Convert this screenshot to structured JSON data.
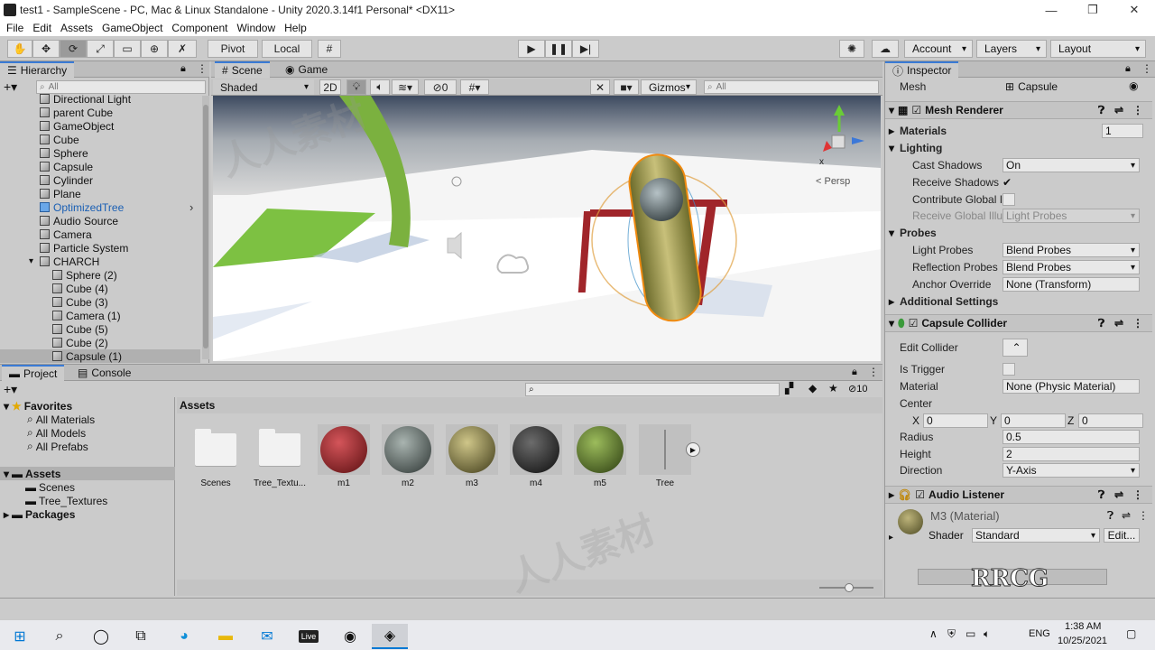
{
  "window": {
    "title": "test1 - SampleScene - PC, Mac & Linux Standalone - Unity 2020.3.14f1 Personal* <DX11>",
    "controls": [
      "—",
      "❐",
      "✕"
    ]
  },
  "menu": [
    "File",
    "Edit",
    "Assets",
    "GameObject",
    "Component",
    "Window",
    "Help"
  ],
  "toolbar": {
    "pivot": "Pivot",
    "local": "Local",
    "account": "Account",
    "layers": "Layers",
    "layout": "Layout"
  },
  "hierarchy": {
    "tab": "Hierarchy",
    "search_placeholder": "All",
    "items": [
      {
        "label": "Directional Light",
        "depth": 1
      },
      {
        "label": "parent Cube",
        "depth": 1
      },
      {
        "label": "GameObject",
        "depth": 1
      },
      {
        "label": "Cube",
        "depth": 1
      },
      {
        "label": "Sphere",
        "depth": 1
      },
      {
        "label": "Capsule",
        "depth": 1
      },
      {
        "label": "Cylinder",
        "depth": 1
      },
      {
        "label": "Plane",
        "depth": 1
      },
      {
        "label": "OptimizedTree",
        "depth": 1,
        "prefab": true
      },
      {
        "label": "Audio Source",
        "depth": 1
      },
      {
        "label": "Camera",
        "depth": 1
      },
      {
        "label": "Particle System",
        "depth": 1
      },
      {
        "label": "CHARCH",
        "depth": 1,
        "expanded": true
      },
      {
        "label": "Sphere (2)",
        "depth": 2
      },
      {
        "label": "Cube (4)",
        "depth": 2
      },
      {
        "label": "Cube (3)",
        "depth": 2
      },
      {
        "label": "Camera (1)",
        "depth": 2
      },
      {
        "label": "Cube (5)",
        "depth": 2
      },
      {
        "label": "Cube (2)",
        "depth": 2
      },
      {
        "label": "Capsule (1)",
        "depth": 2,
        "selected": true
      }
    ]
  },
  "scene": {
    "tabs": [
      "Scene",
      "Game"
    ],
    "shading": "Shaded",
    "mode_2d": "2D",
    "hidden_count": "0",
    "gizmos": "Gizmos",
    "search_placeholder": "All",
    "persp": "< Persp",
    "axis_x": "x"
  },
  "project": {
    "tabs": [
      "Project",
      "Console"
    ],
    "hidden_count": "10",
    "favorites": {
      "label": "Favorites",
      "items": [
        "All Materials",
        "All Models",
        "All Prefabs"
      ]
    },
    "assets_tree": {
      "label": "Assets",
      "children": [
        "Scenes",
        "Tree_Textures"
      ]
    },
    "packages": "Packages",
    "breadcrumb": "Assets",
    "assets": [
      {
        "name": "Scenes",
        "kind": "folder"
      },
      {
        "name": "Tree_Textu...",
        "kind": "folder"
      },
      {
        "name": "m1",
        "kind": "material",
        "color": "#8a1a1a"
      },
      {
        "name": "m2",
        "kind": "material",
        "color": "#4c5650"
      },
      {
        "name": "m3",
        "kind": "material",
        "color": "#6f6a38"
      },
      {
        "name": "m4",
        "kind": "material",
        "color": "#1e1e1e"
      },
      {
        "name": "m5",
        "kind": "material",
        "color": "#4d6a22"
      },
      {
        "name": "Tree",
        "kind": "prefab"
      }
    ]
  },
  "inspector": {
    "tab": "Inspector",
    "mesh_label": "Mesh",
    "mesh_value": "Capsule",
    "mesh_renderer": {
      "title": "Mesh Renderer",
      "materials_label": "Materials",
      "materials_count": "1",
      "lighting_label": "Lighting",
      "cast_shadows_label": "Cast Shadows",
      "cast_shadows_value": "On",
      "receive_shadows_label": "Receive Shadows",
      "contribute_gi_label": "Contribute Global I",
      "receive_gi_label": "Receive Global Illu",
      "receive_gi_value": "Light Probes",
      "probes_label": "Probes",
      "light_probes_label": "Light Probes",
      "light_probes_value": "Blend Probes",
      "reflection_probes_label": "Reflection Probes",
      "reflection_probes_value": "Blend Probes",
      "anchor_override_label": "Anchor Override",
      "anchor_override_value": "None (Transform)",
      "additional_settings_label": "Additional Settings"
    },
    "capsule_collider": {
      "title": "Capsule Collider",
      "edit_collider_label": "Edit Collider",
      "is_trigger_label": "Is Trigger",
      "material_label": "Material",
      "material_value": "None (Physic Material)",
      "center_label": "Center",
      "center": {
        "x": "0",
        "y": "0",
        "z": "0"
      },
      "radius_label": "Radius",
      "radius_value": "0.5",
      "height_label": "Height",
      "height_value": "2",
      "direction_label": "Direction",
      "direction_value": "Y-Axis"
    },
    "audio_listener": {
      "title": "Audio Listener"
    },
    "material": {
      "title": "M3 (Material)",
      "shader_label": "Shader",
      "shader_value": "Standard",
      "edit_label": "Edit..."
    }
  },
  "taskbar": {
    "language": "ENG",
    "time": "1:38 AM",
    "date": "10/25/2021",
    "live_label": "Live"
  }
}
